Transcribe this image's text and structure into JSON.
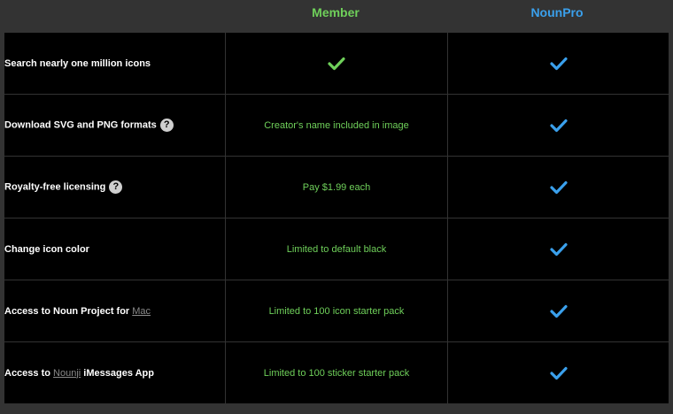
{
  "headers": {
    "member": "Member",
    "pro": "NounPro"
  },
  "colors": {
    "member_accent": "#6fd05a",
    "pro_accent": "#3aa0ec",
    "background": "#000000"
  },
  "help_icon": "question-circle-icon",
  "check_icon": "checkmark-icon",
  "rows": [
    {
      "feature": "Search nearly one million icons",
      "member": "",
      "member_check": true,
      "pro_check": true
    },
    {
      "feature": "Download SVG and PNG formats",
      "help": true,
      "member": "Creator's name included in image",
      "pro_check": true
    },
    {
      "feature": "Royalty-free licensing",
      "help": true,
      "member": "Pay $1.99 each",
      "pro_check": true
    },
    {
      "feature": "Change icon color",
      "member": "Limited to default black",
      "pro_check": true
    },
    {
      "feature_prefix": "Access to Noun Project for",
      "feature_link": "Mac",
      "feature_suffix": "",
      "member": "Limited to 100 icon starter pack",
      "pro_check": true
    },
    {
      "feature_prefix": "Access to",
      "feature_link": "Nounji",
      "feature_suffix": "iMessages App",
      "member": "Limited to 100 sticker starter pack",
      "pro_check": true
    }
  ]
}
